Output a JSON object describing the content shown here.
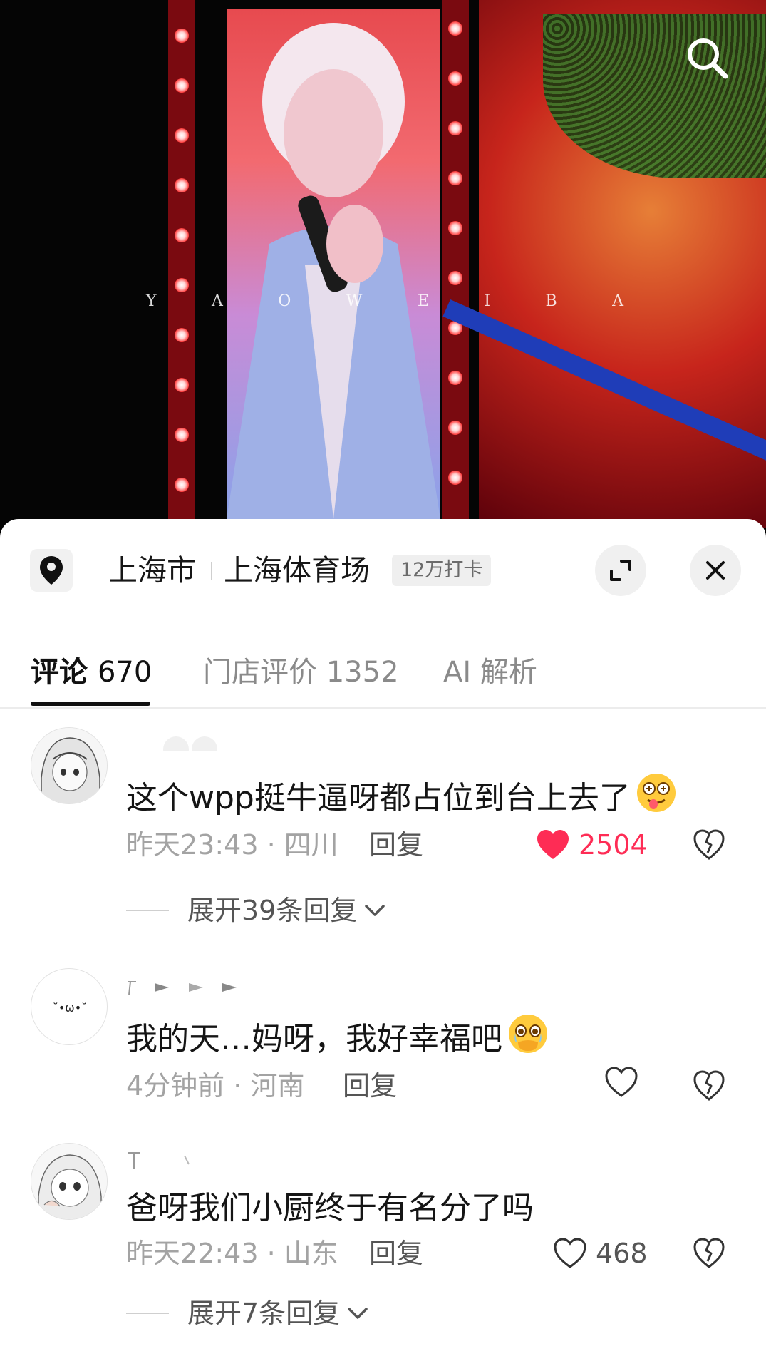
{
  "video": {
    "watermark_letters": [
      "Y",
      "A",
      "O",
      "W",
      "E",
      "I",
      "B",
      "A"
    ]
  },
  "location": {
    "city": "上海市",
    "venue": "上海体育场",
    "checkins": "12万打卡"
  },
  "tabs": [
    {
      "label": "评论",
      "count": "670"
    },
    {
      "label": "门店评价",
      "count": "1352"
    },
    {
      "label": "AI 解析",
      "count": ""
    }
  ],
  "comments": [
    {
      "text": "这个wpp挺牛逼呀都占位到台上去了",
      "emoji": "dizzy-tongue-emoji",
      "time": "昨天23:43",
      "region": "四川",
      "reply_label": "回复",
      "likes": "2504",
      "liked": true,
      "expand_label": "展开39条回复"
    },
    {
      "text": "我的天…妈呀，我好幸福吧",
      "emoji": "holding-back-tears-emoji",
      "time": "4分钟前",
      "region": "河南",
      "reply_label": "回复",
      "likes": "",
      "liked": false,
      "expand_label": ""
    },
    {
      "text": "爸呀我们小厨终于有名分了吗",
      "emoji": "",
      "time": "昨天22:43",
      "region": "山东",
      "reply_label": "回复",
      "likes": "468",
      "liked": false,
      "expand_label": "展开7条回复"
    }
  ],
  "colors": {
    "like_red": "#fe2c55",
    "text_primary": "#151515",
    "text_muted": "#a3a3a3"
  },
  "icons": [
    "search-icon",
    "location-pin-icon",
    "expand-icon",
    "close-icon",
    "heart-icon",
    "dislike-broken-heart-icon",
    "chevron-down-icon"
  ]
}
